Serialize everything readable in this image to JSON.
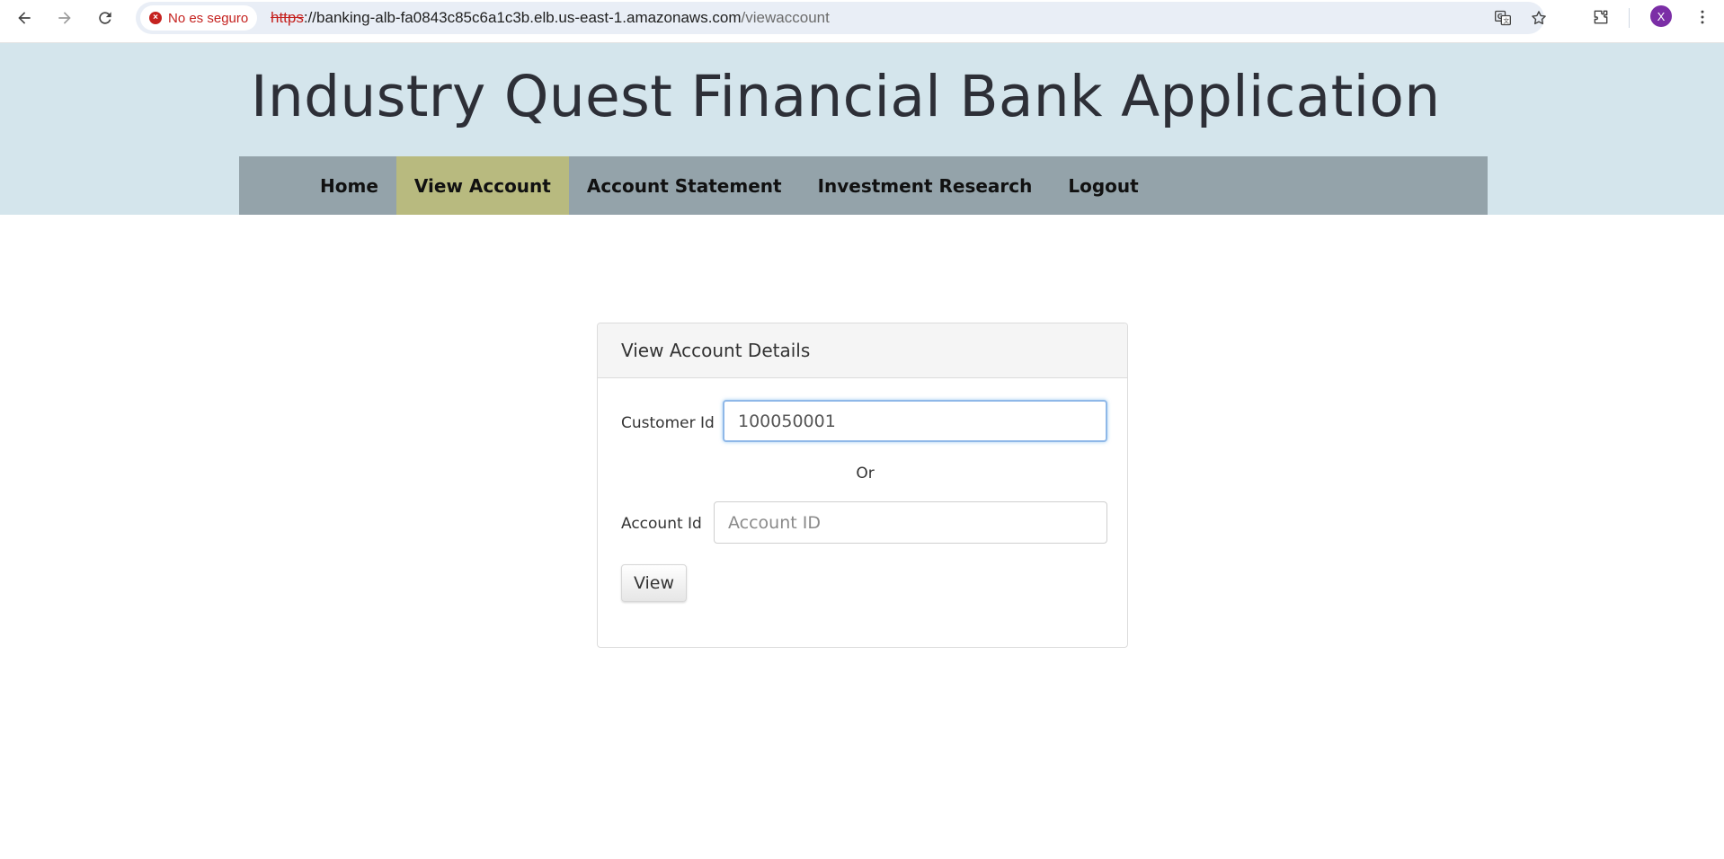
{
  "browser": {
    "security_label": "No es seguro",
    "url_scheme": "https",
    "url_host": "://banking-alb-fa0843c85c6a1c3b.elb.us-east-1.amazonaws.com",
    "url_path": "/viewaccount",
    "profile_initial": "X",
    "icons": [
      "back-icon",
      "forward-icon",
      "reload-icon",
      "not-secure-icon",
      "translate-icon",
      "bookmark-star-icon",
      "extensions-icon",
      "kebab-menu-icon"
    ]
  },
  "site": {
    "title": "Industry Quest Financial Bank Application",
    "colors": {
      "header_bg": "#d4e5ec",
      "navbar_bg": "#94a3aa",
      "active_tab_bg": "#b8ba7f"
    }
  },
  "nav": {
    "items": [
      {
        "label": "Home",
        "active": false
      },
      {
        "label": "View Account",
        "active": true
      },
      {
        "label": "Account Statement",
        "active": false
      },
      {
        "label": "Investment Research",
        "active": false
      },
      {
        "label": "Logout",
        "active": false
      }
    ]
  },
  "panel": {
    "heading": "View Account Details",
    "customer_label": "Customer Id",
    "customer_value": "100050001",
    "or_text": "Or",
    "account_label": "Account Id",
    "account_value": "",
    "account_placeholder": "Account ID",
    "view_button": "View"
  }
}
